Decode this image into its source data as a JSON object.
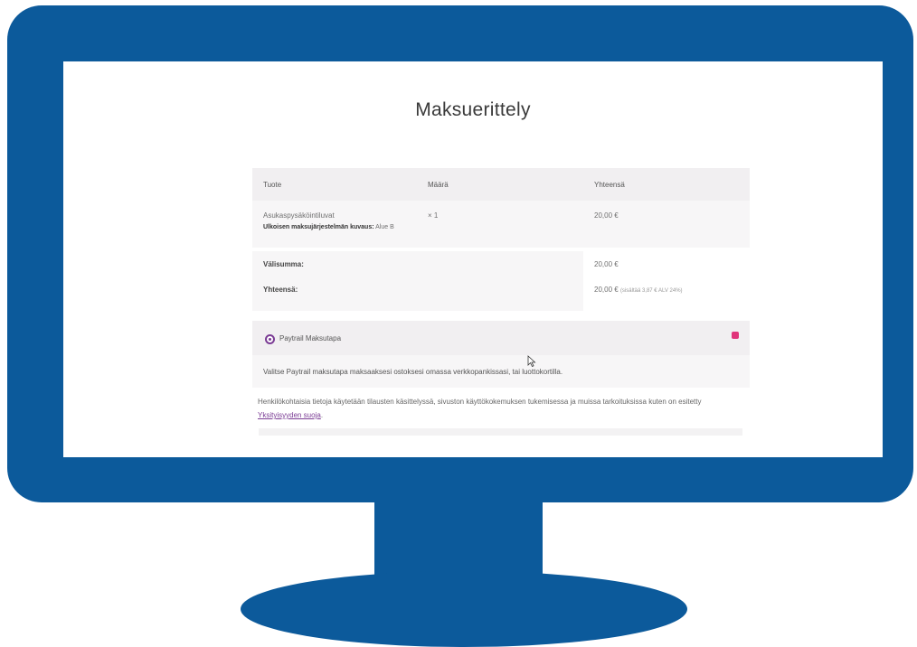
{
  "page": {
    "title": "Maksuerittely"
  },
  "order": {
    "headers": [
      "Tuote",
      "Määrä",
      "Yhteensä"
    ],
    "item": {
      "name": "Asukaspysäköintiluvat",
      "meta_label": "Ulkoisen maksujärjestelmän kuvaus:",
      "meta_value": "Alue B",
      "quantity": "× 1",
      "total": "20,00 €"
    },
    "subtotal_label": "Välisumma:",
    "subtotal_value": "20,00 €",
    "total_label": "Yhteensä:",
    "total_value": "20,00 €",
    "total_note": "(sisältää 3,87 € ALV 24%)"
  },
  "payment": {
    "method_label": "Paytrail Maksutapa",
    "description": "Valitse Paytrail maksutapa maksaaksesi ostoksesi omassa verkkopankissasi, tai luottokortilla."
  },
  "privacy": {
    "text": "Henkilökohtaisia tietoja käytetään tilausten käsittelyssä, sivuston käyttökokemuksen tukemisessa ja muissa tarkoituksissa kuten on esitetty",
    "link": "Yksityisyyden suoja",
    "end": "."
  },
  "colors": {
    "monitor": "#0c5a9b",
    "accent": "#7a3b94",
    "payment_icon": "#e0337a"
  }
}
